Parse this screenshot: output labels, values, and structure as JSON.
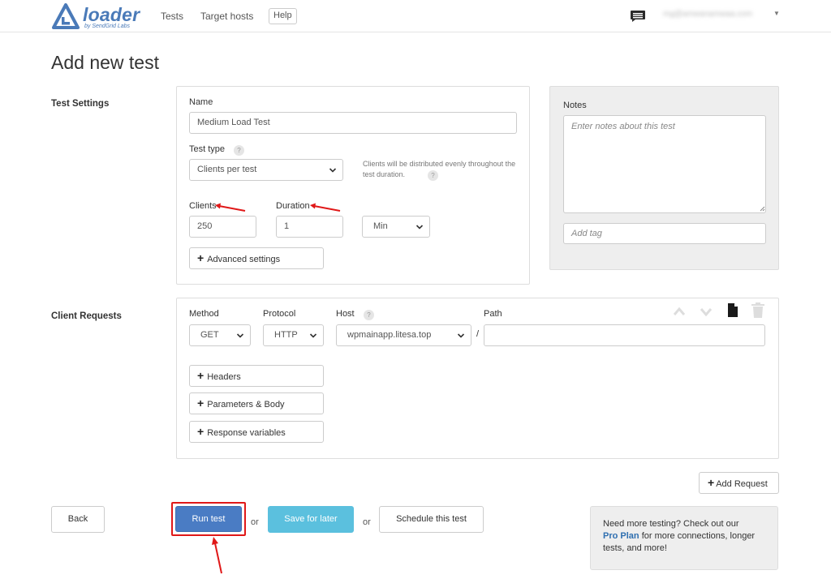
{
  "brand": {
    "name": "loader",
    "tagline": "by SendGrid Labs",
    "color": "#4a7ab8"
  },
  "nav": {
    "tests": "Tests",
    "target_hosts": "Target hosts",
    "help": "Help",
    "chat_icon": "chat-bubble-icon"
  },
  "user": {
    "email": "mg@amwanamwaa.com"
  },
  "page": {
    "title": "Add new test"
  },
  "test_settings": {
    "section_label": "Test Settings",
    "name_label": "Name",
    "name_value": "Medium Load Test",
    "test_type_label": "Test type",
    "test_type_value": "Clients per test",
    "test_type_hint": "Clients will be distributed evenly throughout the test duration.",
    "help_symbol": "?",
    "clients_label": "Clients",
    "clients_value": "250",
    "duration_label": "Duration",
    "duration_value": "1",
    "duration_unit": "Min",
    "advanced_button": "Advanced settings"
  },
  "notes": {
    "label": "Notes",
    "placeholder": "Enter notes about this test",
    "tag_placeholder": "Add tag"
  },
  "client_requests": {
    "section_label": "Client Requests",
    "method_label": "Method",
    "method_value": "GET",
    "protocol_label": "Protocol",
    "protocol_value": "HTTP",
    "host_label": "Host",
    "host_value": "wpmainapp.litesa.top",
    "path_label": "Path",
    "path_separator": "/",
    "path_value": "",
    "headers_button": "Headers",
    "params_button": "Parameters & Body",
    "response_vars_button": "Response variables",
    "add_request_button": "Add Request"
  },
  "actions": {
    "back": "Back",
    "run_test": "Run test",
    "or": "or",
    "save_for_later": "Save for later",
    "schedule": "Schedule this test"
  },
  "promo": {
    "before": "Need more testing? Check out our",
    "link": "Pro Plan",
    "after": "for more connections, longer tests, and more!"
  },
  "colors": {
    "primary": "#4a7cc4",
    "info": "#5bc0de",
    "annotation_red": "#e01818"
  }
}
